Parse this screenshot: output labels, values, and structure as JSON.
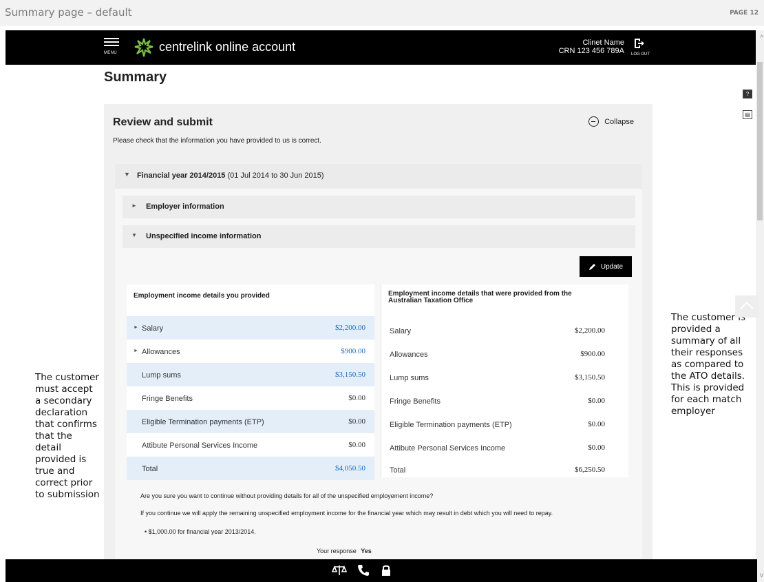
{
  "doc": {
    "title": "Summary page – default",
    "page": "PAGE 12"
  },
  "header": {
    "menu_label": "MENU",
    "brand": "centrelink online account",
    "client_name": "Clinet Name",
    "crn": "CRN 123 456 789A",
    "logout_label": "LOG OUT"
  },
  "page_title": "Summary",
  "review": {
    "title": "Review and submit",
    "subtitle": "Please check that the information you have provided to us is correct.",
    "collapse_label": "Collapse",
    "fy_label": "Financial year 2014/2015",
    "fy_range": "(01 Jul 2014 to 30 Jun 2015)",
    "sections": [
      "Employer information",
      "Unspecified income information"
    ],
    "update_label": "Update"
  },
  "provided": {
    "heading": "Employment income details you provided",
    "rows": [
      {
        "label": "Salary",
        "value": "$2,200.00"
      },
      {
        "label": "Allowances",
        "value": "$900.00"
      },
      {
        "label": "Lump sums",
        "value": "$3,150.50"
      },
      {
        "label": "Fringe Benefits",
        "value": "$0.00"
      },
      {
        "label": "Eligible Termination payments (ETP)",
        "value": "$0.00"
      },
      {
        "label": "Attibute Personal Services Income",
        "value": "$0.00"
      },
      {
        "label": "Total",
        "value": "$4,050.50"
      }
    ]
  },
  "ato": {
    "heading_line1": "Employment income details that were provided from the",
    "heading_line2": "Australian Taxation Office",
    "rows": [
      {
        "label": "Salary",
        "value": "$2,200.00"
      },
      {
        "label": "Allowances",
        "value": "$900.00"
      },
      {
        "label": "Lump sums",
        "value": "$3,150.50"
      },
      {
        "label": "Fringe Benefits",
        "value": "$0.00"
      },
      {
        "label": "Eligible Termination payments (ETP)",
        "value": "$0.00"
      },
      {
        "label": "Attibute Personal Services Income",
        "value": "$0.00"
      },
      {
        "label": "Total",
        "value": "$6,250.50"
      }
    ]
  },
  "question": {
    "q": "Are you sure you want to continue without providing details for all of the unspecified employement income?",
    "warn": "If you continue we will apply the remaining unspecified employment income for the financial year which may result in debt which you will need to repay.",
    "bullet": "• $1,000.00 for financial year 2013/2014.",
    "response_label": "Your response",
    "response_value": "Yes"
  },
  "notes": {
    "left": "The customer must accept a secondary declaration that confirms that the detail provided is true and correct prior to submission",
    "right": "The customer is provided a summary of all their responses as compared to the ATO details. This is provided for each match employer"
  },
  "icons": {
    "help": "help-icon",
    "print": "print-icon",
    "footer": [
      "scales-icon",
      "phone-icon",
      "lock-icon"
    ]
  },
  "colors": {
    "accent_blue": "#1f6bb5",
    "row_blue": "#e3eef9",
    "bar_black": "#000000"
  }
}
